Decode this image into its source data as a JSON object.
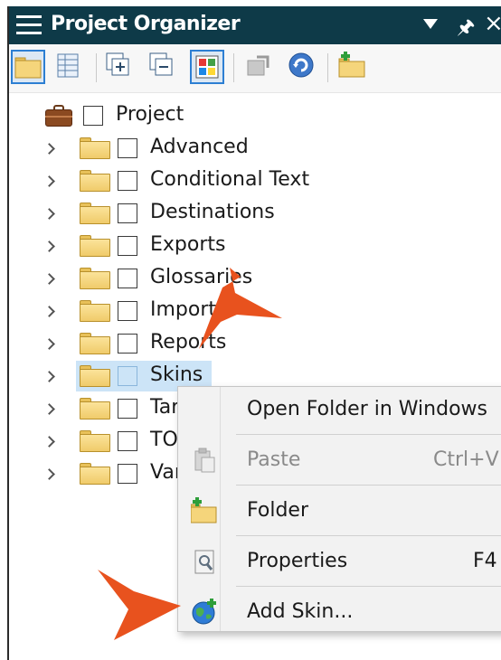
{
  "window": {
    "title": "Project Organizer"
  },
  "toolbar": {
    "buttons": [
      {
        "icon": "open-folder-icon",
        "selected": true
      },
      {
        "icon": "table-view-icon",
        "selected": false
      },
      {
        "icon": "expand-all-icon",
        "selected": false
      },
      {
        "icon": "collapse-all-icon",
        "selected": false
      },
      {
        "icon": "color-grid-icon",
        "selected": true
      },
      {
        "icon": "disabled-action-icon",
        "selected": false
      },
      {
        "icon": "refresh-icon",
        "selected": false
      },
      {
        "icon": "new-folder-icon",
        "selected": false
      }
    ]
  },
  "tree": {
    "root": {
      "label": "Project",
      "icon": "briefcase-icon"
    },
    "items": [
      {
        "label": "Advanced"
      },
      {
        "label": "Conditional Text"
      },
      {
        "label": "Destinations"
      },
      {
        "label": "Exports"
      },
      {
        "label": "Glossaries"
      },
      {
        "label": "Imports"
      },
      {
        "label": "Reports"
      },
      {
        "label": "Skins",
        "selected": true
      },
      {
        "label": "Targets"
      },
      {
        "label": "TOCs"
      },
      {
        "label": "Variables"
      }
    ]
  },
  "context_menu": {
    "items": [
      {
        "label": "Open Folder in Windows",
        "shortcut": "",
        "icon": "",
        "disabled": false
      },
      {
        "label": "Paste",
        "shortcut": "Ctrl+V",
        "icon": "paste-icon",
        "disabled": true
      },
      {
        "label": "Folder",
        "shortcut": "",
        "icon": "new-folder-icon",
        "disabled": false
      },
      {
        "label": "Properties",
        "shortcut": "F4",
        "icon": "properties-icon",
        "disabled": false
      },
      {
        "label": "Add Skin...",
        "shortcut": "",
        "icon": "globe-add-icon",
        "disabled": false
      }
    ]
  },
  "colors": {
    "title_bar": "#0e3a48",
    "selection": "#cce4f7",
    "callout_arrow": "#e8521e",
    "folder": "#f0cb6a"
  }
}
